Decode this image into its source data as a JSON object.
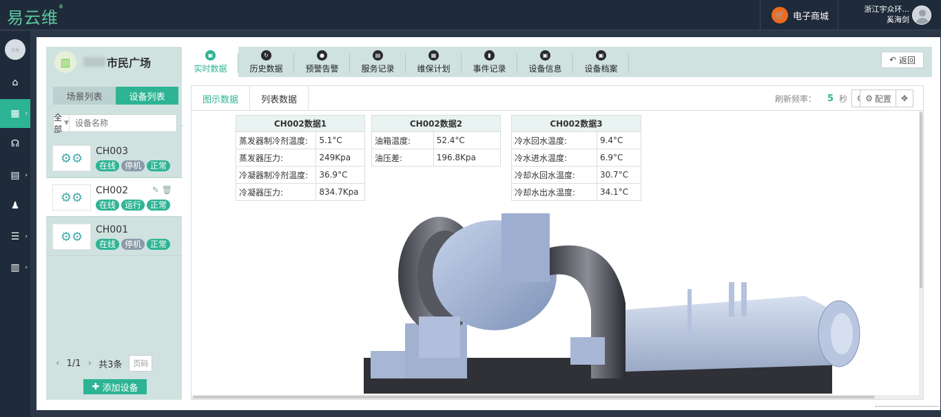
{
  "header": {
    "logo": "易云维",
    "logo_mark": "®",
    "shop_label": "电子商城",
    "user_company": "浙江宇众环...",
    "user_name": "奚海剑"
  },
  "sidebar_nav": {
    "avatar_text": "天地",
    "items": [
      {
        "icon": "home-icon"
      },
      {
        "icon": "grid-icon",
        "active": true
      },
      {
        "icon": "router-icon"
      },
      {
        "icon": "clipboard-icon"
      },
      {
        "icon": "user-icon"
      },
      {
        "icon": "contacts-icon"
      },
      {
        "icon": "building-icon"
      }
    ]
  },
  "project": {
    "name": "市民广场"
  },
  "side_tabs": {
    "scene_list": "场景列表",
    "device_list": "设备列表"
  },
  "filter": {
    "select_value": "全部",
    "search_placeholder": "设备名称"
  },
  "devices": [
    {
      "name": "CH003",
      "online": "在线",
      "state": "停机",
      "health": "正常"
    },
    {
      "name": "CH002",
      "online": "在线",
      "state": "运行",
      "health": "正常"
    },
    {
      "name": "CH001",
      "online": "在线",
      "state": "停机",
      "health": "正常"
    }
  ],
  "pager": {
    "page": "1/1",
    "total": "共3条",
    "page_input_placeholder": "页码"
  },
  "add_device_label": "添加设备",
  "tabs": [
    "实时数据",
    "历史数据",
    "预警告警",
    "服务记录",
    "维保计划",
    "事件记录",
    "设备信息",
    "设备档案"
  ],
  "back_label": "返回",
  "view_tabs": {
    "chart": "图示数据",
    "list": "列表数据"
  },
  "refresh": {
    "label": "刷新频率：",
    "value": "5",
    "unit": "秒"
  },
  "config_label": "配置",
  "tables": [
    {
      "title": "CH002数据1",
      "rows": [
        [
          "蒸发器制冷剂温度:",
          "5.1°C"
        ],
        [
          "蒸发器压力:",
          "249Kpa"
        ],
        [
          "冷凝器制冷剂温度:",
          "36.9°C"
        ],
        [
          "冷凝器压力:",
          "834.7Kpa"
        ]
      ]
    },
    {
      "title": "CH002数据2",
      "rows": [
        [
          "油箱温度:",
          "52.4°C"
        ],
        [
          "油压差:",
          "196.8Kpa"
        ]
      ]
    },
    {
      "title": "CH002数据3",
      "rows": [
        [
          "冷水回水温度:",
          "9.4°C"
        ],
        [
          "冷水进水温度:",
          "6.9°C"
        ],
        [
          "冷却水回水温度:",
          "30.7°C"
        ],
        [
          "冷却水出水温度:",
          "34.1°C"
        ]
      ]
    }
  ],
  "colors": {
    "accent": "#2db494",
    "nav_bg": "#1f2b3a",
    "panel_bg": "#cfe2e0",
    "badge_grey": "#8a9aa8",
    "shop_orange": "#f06a1e"
  }
}
